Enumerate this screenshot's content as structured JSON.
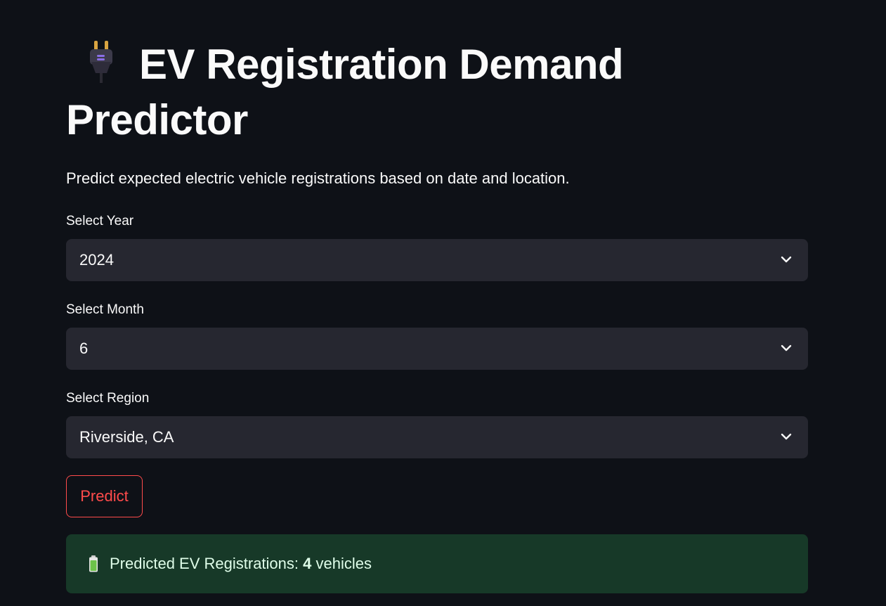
{
  "header": {
    "title": "EV Registration Demand Predictor",
    "title_icon": "electric-plug-icon",
    "subtitle": "Predict expected electric vehicle registrations based on date and location."
  },
  "form": {
    "year": {
      "label": "Select Year",
      "value": "2024"
    },
    "month": {
      "label": "Select Month",
      "value": "6"
    },
    "region": {
      "label": "Select Region",
      "value": "Riverside, CA"
    },
    "predict_label": "Predict"
  },
  "result": {
    "icon": "battery-icon",
    "prefix": "Predicted EV Registrations: ",
    "value": "4",
    "unit": " vehicles"
  },
  "colors": {
    "background": "#0e1117",
    "input_background": "#262730",
    "accent": "#ff4b4b",
    "success_background": "#173928",
    "success_text": "#dffde9"
  }
}
